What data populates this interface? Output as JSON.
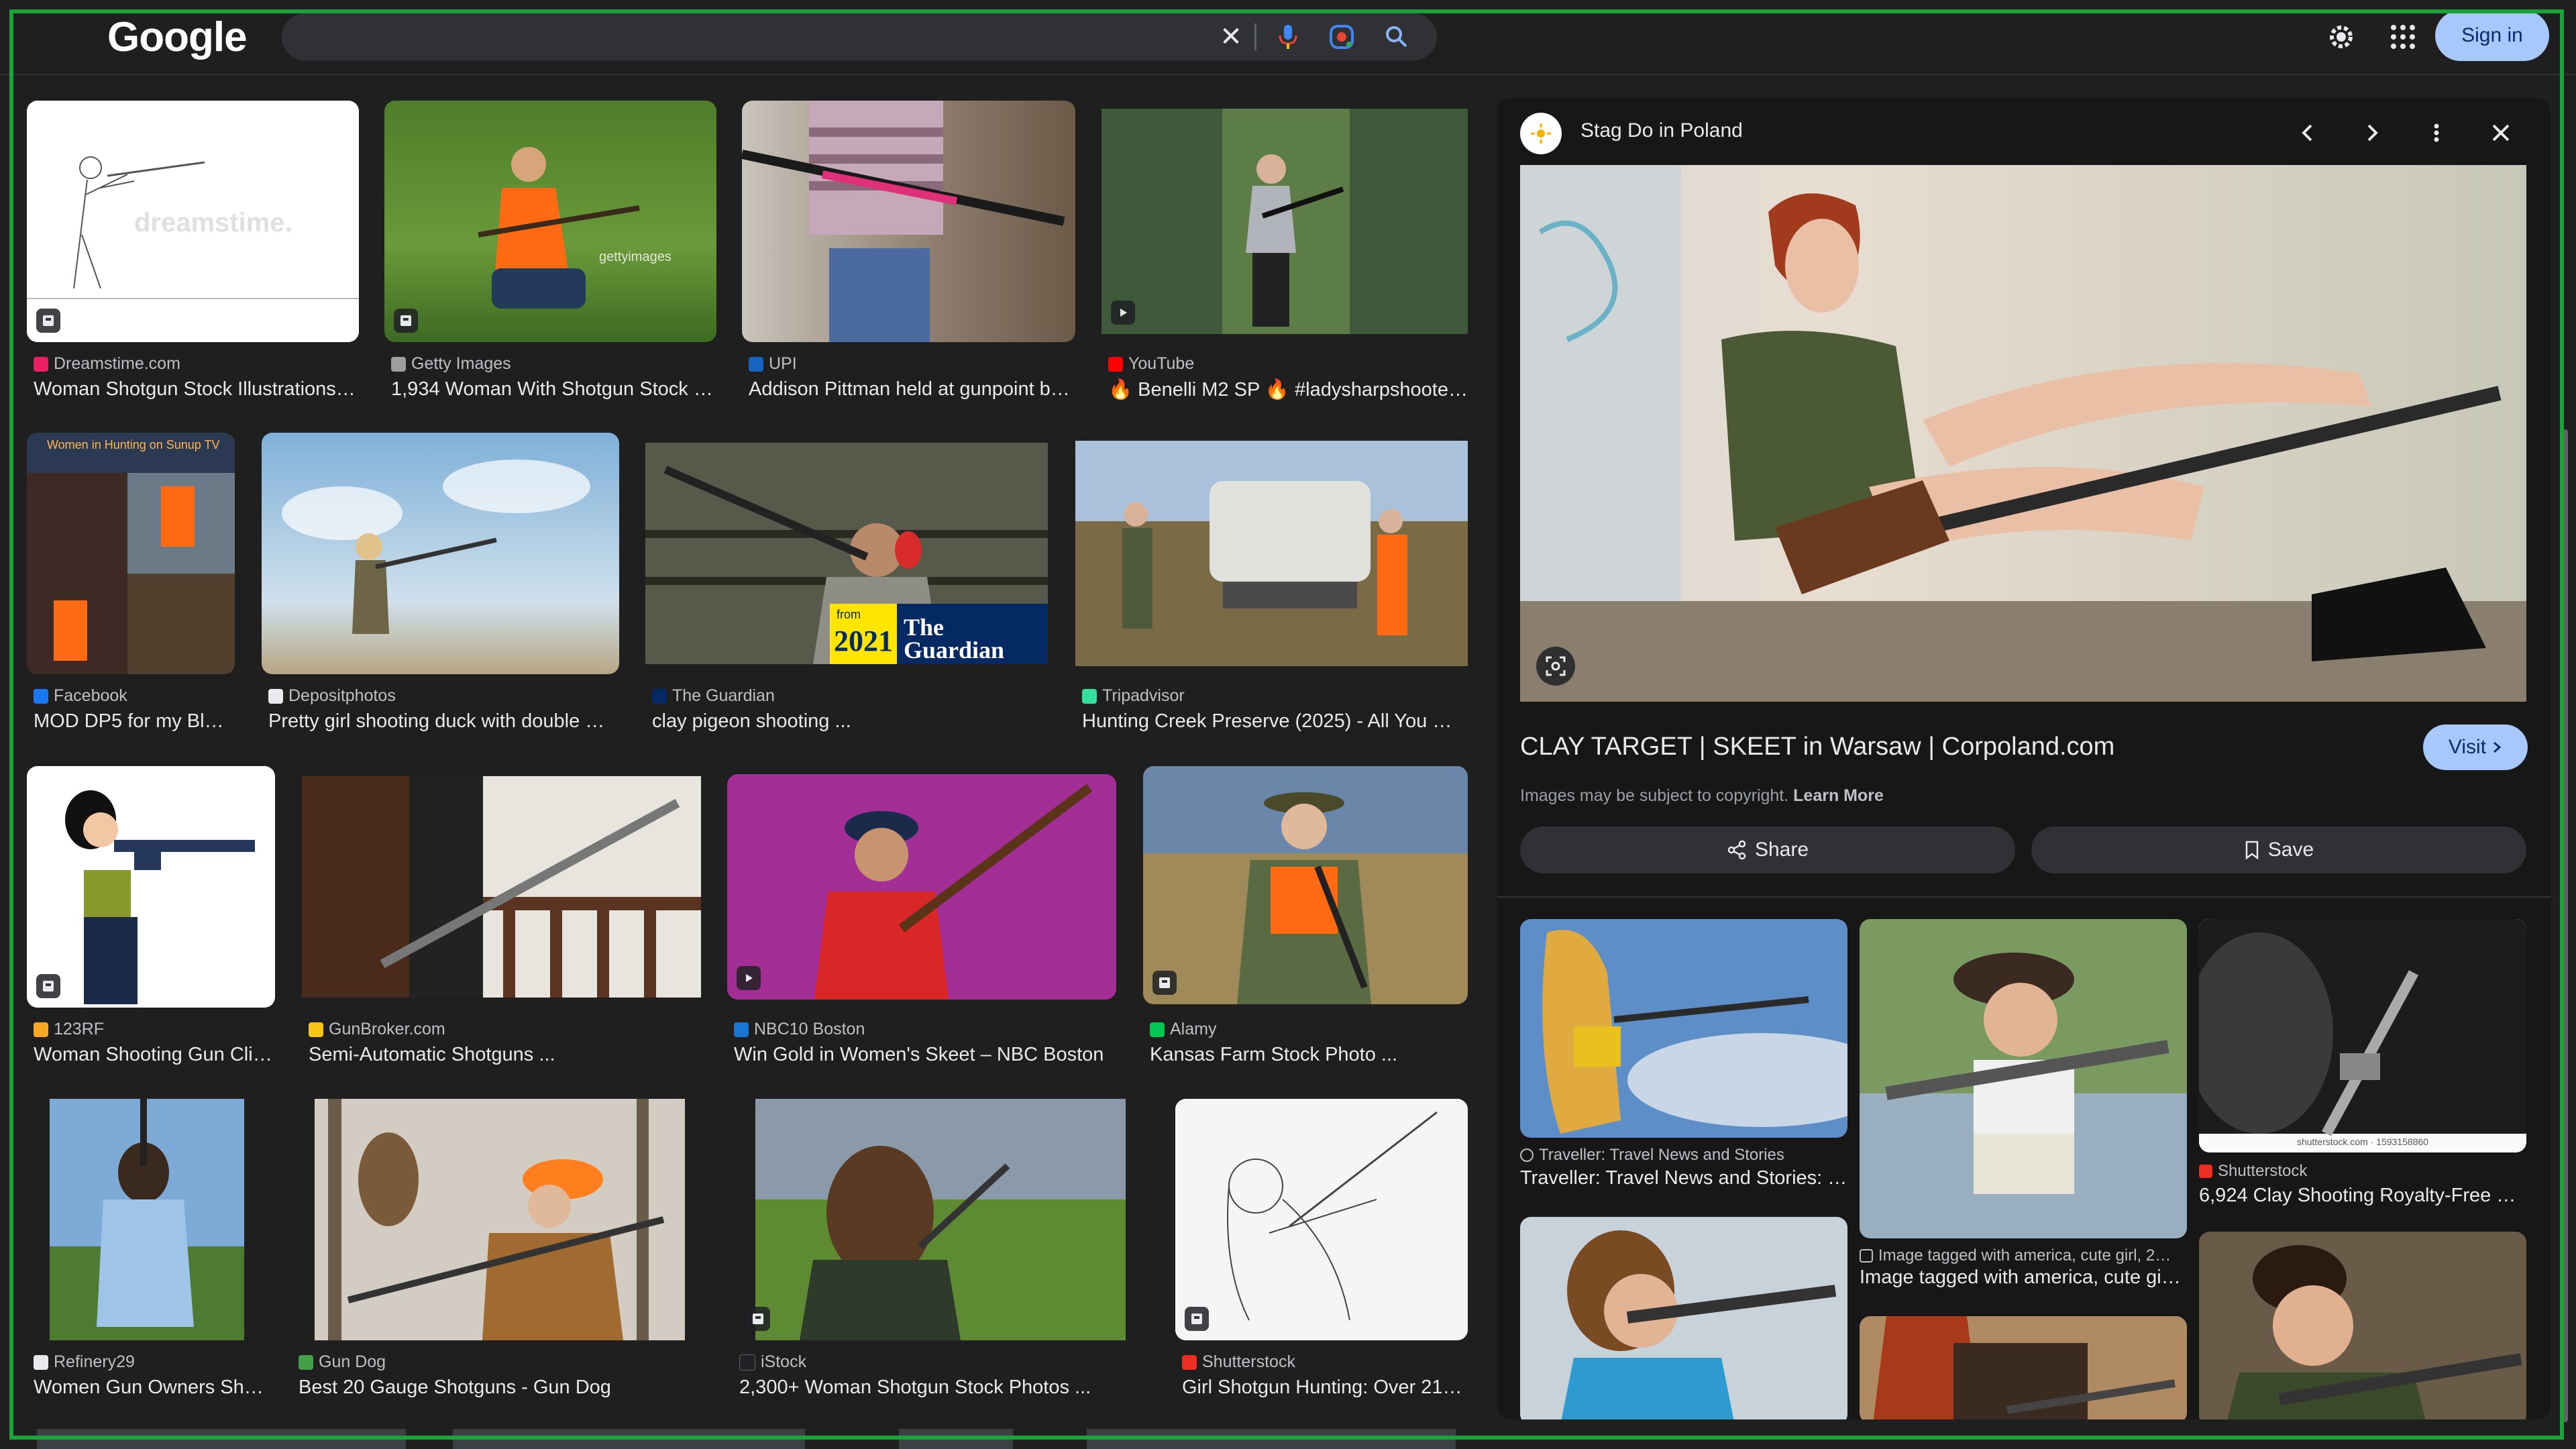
{
  "header": {
    "logo": "Google",
    "search_value": "",
    "signin_label": "Sign in"
  },
  "results": [
    {
      "source": "Dreamstime.com",
      "title": "Woman Shotgun Stock Illustrations…",
      "fav": "#e91e63"
    },
    {
      "source": "Getty Images",
      "title": "1,934 Woman With Shotgun Stock …",
      "fav": "#9e9e9e"
    },
    {
      "source": "UPI",
      "title": "Addison Pittman held at gunpoint b…",
      "fav": "#1565c0"
    },
    {
      "source": "YouTube",
      "title": "🔥 Benelli M2 SP 🔥 #ladysharpshoote…",
      "fav": "#ff0000"
    },
    {
      "source": "Facebook",
      "title": "MOD DP5 for my Bl…",
      "fav": "#1877f2"
    },
    {
      "source": "Depositphotos",
      "title": "Pretty girl shooting duck with double …",
      "fav": "#e8eaed"
    },
    {
      "source": "The Guardian",
      "title": "clay pigeon shooting ...",
      "fav": "#052962"
    },
    {
      "source": "Tripadvisor",
      "title": "Hunting Creek Preserve (2025) - All You …",
      "fav": "#34e0a1"
    },
    {
      "source": "123RF",
      "title": "Woman Shooting Gun Cli…",
      "fav": "#f9a825"
    },
    {
      "source": "GunBroker.com",
      "title": "Semi-Automatic Shotguns ...",
      "fav": "#f5c518"
    },
    {
      "source": "NBC10 Boston",
      "title": "Win Gold in Women's Skeet – NBC Boston",
      "fav": "#1976d2"
    },
    {
      "source": "Alamy",
      "title": "Kansas Farm Stock Photo ...",
      "fav": "#00c853"
    },
    {
      "source": "Refinery29",
      "title": "Women Gun Owners Sh…",
      "fav": "#e8eaed"
    },
    {
      "source": "Gun Dog",
      "title": "Best 20 Gauge Shotguns - Gun Dog",
      "fav": "#43a047"
    },
    {
      "source": "iStock",
      "title": "2,300+ Woman Shotgun Stock Photos ...",
      "fav": "#202124"
    },
    {
      "source": "Shutterstock",
      "title": "Girl Shotgun Hunting: Over 21…",
      "fav": "#ee2e24"
    }
  ],
  "panel": {
    "site": "Stag Do in Poland",
    "title": "CLAY TARGET | SKEET in Warsaw | Corpoland.com",
    "visit_label": "Visit",
    "copyright": "Images may be subject to copyright.",
    "learn_more": "Learn More",
    "share_label": "Share",
    "save_label": "Save",
    "related": [
      {
        "source": "Traveller: Travel News and Stories",
        "title": "Traveller: Travel News and Stories: …"
      },
      {
        "source": "Image tagged with america, cute girl, 2…",
        "title": "Image tagged with america, cute gir…"
      },
      {
        "source": "Shutterstock",
        "title": "6,924 Clay Shooting Royalty-Free …"
      }
    ]
  },
  "overlays": {
    "watermark1": "dreamstime.",
    "watermark2": "gettyimages",
    "guardian_from": "from",
    "guardian_year": "2021",
    "guardian_name": "The Guardian",
    "facebook_headline": "Women in Hunting on Sunup TV",
    "shutterstock_id": "shutterstock.com · 1593158860"
  }
}
